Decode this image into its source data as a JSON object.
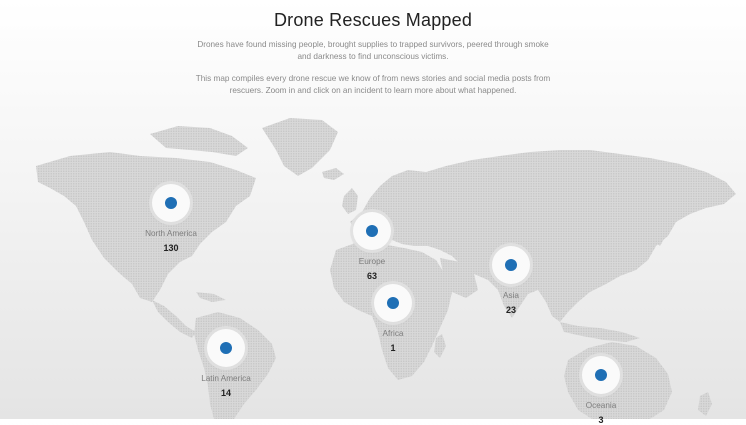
{
  "header": {
    "title": "Drone Rescues Mapped",
    "intro_1": "Drones have found missing people, brought supplies to trapped survivors, peered through smoke and darkness to find unconscious victims.",
    "intro_2": "This map compiles every drone rescue we know of from news stories and social media posts from rescuers. Zoom in and click on an incident to learn more about what happened."
  },
  "colors": {
    "marker": "#1f6fb5",
    "land": "#cfcfcf"
  },
  "regions": [
    {
      "name": "North America",
      "count": "130"
    },
    {
      "name": "Europe",
      "count": "63"
    },
    {
      "name": "Asia",
      "count": "23"
    },
    {
      "name": "Africa",
      "count": "1"
    },
    {
      "name": "Latin America",
      "count": "14"
    },
    {
      "name": "Oceania",
      "count": "3"
    }
  ]
}
